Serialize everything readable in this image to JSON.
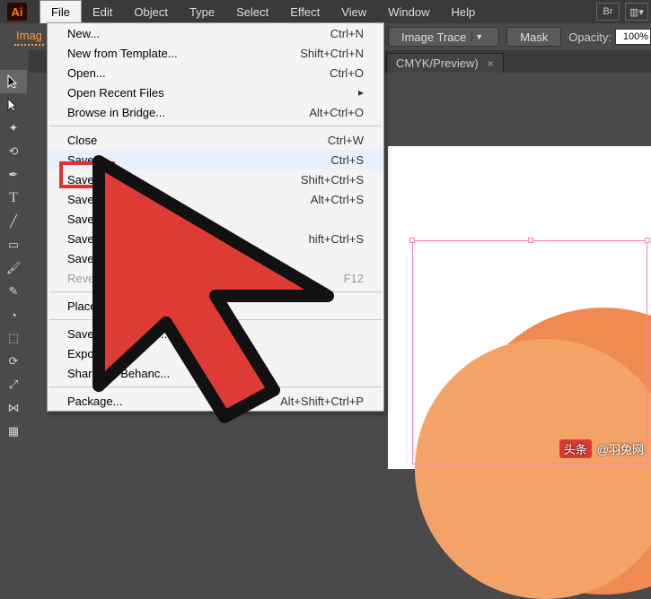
{
  "logo": "Ai",
  "menubar": [
    "File",
    "Edit",
    "Object",
    "Type",
    "Select",
    "Effect",
    "View",
    "Window",
    "Help"
  ],
  "ctrl": {
    "imageLabel": "Imag",
    "traceBtn": "Image Trace",
    "maskBtn": "Mask",
    "opacityLabel": "Opacity:",
    "opacityValue": "100%"
  },
  "doctab": {
    "title": "CMYK/Preview)",
    "close": "×"
  },
  "fileMenu": [
    {
      "label": "New...",
      "shortcut": "Ctrl+N"
    },
    {
      "label": "New from Template...",
      "shortcut": "Shift+Ctrl+N"
    },
    {
      "label": "Open...",
      "shortcut": "Ctrl+O"
    },
    {
      "label": "Open Recent Files",
      "shortcut": "",
      "submenu": true
    },
    {
      "label": "Browse in Bridge...",
      "shortcut": "Alt+Ctrl+O"
    },
    {
      "sep": true
    },
    {
      "label": "Close",
      "shortcut": "Ctrl+W"
    },
    {
      "label": "Save",
      "shortcut": "Ctrl+S",
      "highlight": true
    },
    {
      "label": "Save",
      "shortcut": "Shift+Ctrl+S"
    },
    {
      "label": "Save a",
      "shortcut": "Alt+Ctrl+S"
    },
    {
      "label": "Save as",
      "shortcut": ""
    },
    {
      "label": "Save for",
      "shortcut": "hift+Ctrl+S"
    },
    {
      "label": "Save Sele",
      "shortcut": ""
    },
    {
      "label": "Revert",
      "shortcut": "F12",
      "disabled": true
    },
    {
      "sep": true
    },
    {
      "label": "Place...",
      "shortcut": ""
    },
    {
      "sep": true
    },
    {
      "label": "Save for Micro           ice...",
      "shortcut": ""
    },
    {
      "label": "Export...",
      "shortcut": ""
    },
    {
      "label": "Share On Behanc...",
      "shortcut": ""
    },
    {
      "sep": true
    },
    {
      "label": "Package...",
      "shortcut": "Alt+Shift+Ctrl+P"
    }
  ],
  "watermark": {
    "badge": "头条",
    "text": "@羽兔网"
  }
}
